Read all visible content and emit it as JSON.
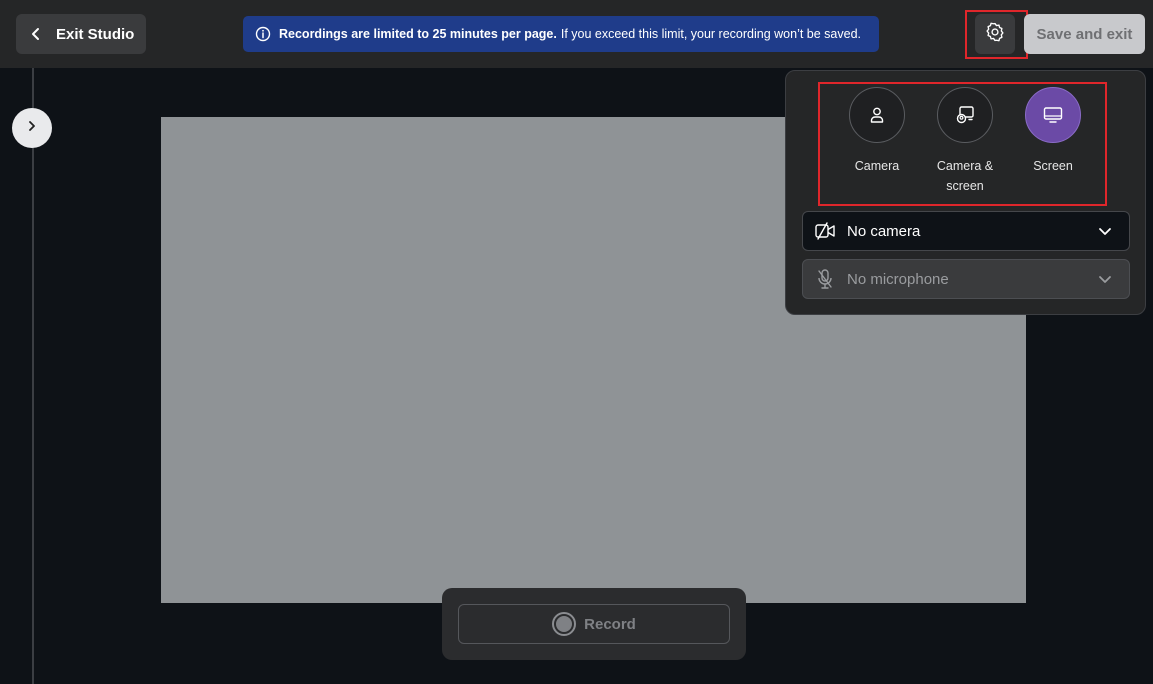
{
  "header": {
    "exit_label": "Exit Studio",
    "banner_bold": "Recordings are limited to 25 minutes per page.",
    "banner_text": "If you exceed this limit, your recording won’t be saved.",
    "save_label": "Save and exit"
  },
  "panel": {
    "modes": [
      {
        "label": "Camera",
        "icon": "person-icon",
        "active": false
      },
      {
        "label": "Camera & screen",
        "icon": "camera-screen-icon",
        "active": false
      },
      {
        "label": "Screen",
        "icon": "monitor-icon",
        "active": true
      }
    ],
    "camera_select": "No camera",
    "mic_select": "No microphone"
  },
  "record": {
    "label": "Record"
  },
  "colors": {
    "accent_active": "#6b4aa6",
    "banner": "#1f3c8a",
    "highlight": "#e0262b"
  }
}
